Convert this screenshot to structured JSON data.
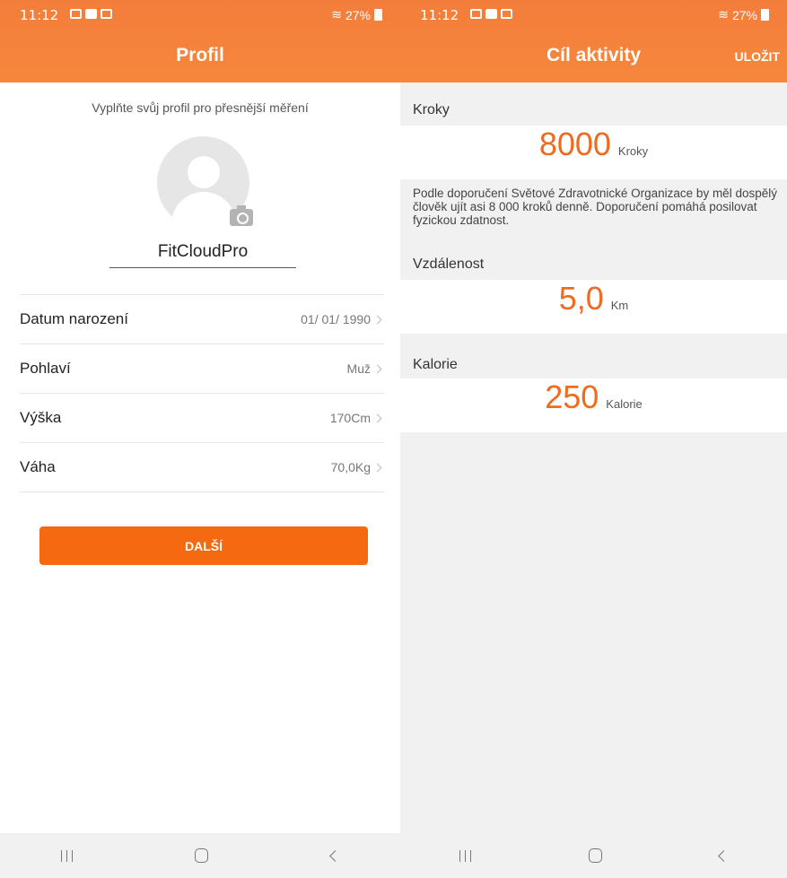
{
  "left": {
    "status": {
      "time": "11:12",
      "signal_battery": "27%"
    },
    "title": "Profil",
    "hint": "Vyplňte svůj profil pro přesnější měření",
    "username": "FitCloudPro",
    "rows": [
      {
        "label": "Datum narození",
        "value": "01/ 01/ 1990"
      },
      {
        "label": "Pohlaví",
        "value": "Muž"
      },
      {
        "label": "Výška",
        "value": "170Cm"
      },
      {
        "label": "Váha",
        "value": "70,0Kg"
      }
    ],
    "next_label": "DALŠÍ"
  },
  "right": {
    "status": {
      "time": "11:12",
      "signal_battery": "27%"
    },
    "title": "Cíl aktivity",
    "save_label": "ULOŽIT",
    "steps": {
      "label": "Kroky",
      "value": "8000",
      "unit": "Kroky"
    },
    "description": "Podle doporučení Světové Zdravotnické Organizace by měl dospělý člověk ujít asi 8 000 kroků denně. Doporučení pomáhá posilovat fyzickou zdatnost.",
    "distance": {
      "label": "Vzdálenost",
      "value": "5,0",
      "unit": "Km"
    },
    "calories": {
      "label": "Kalorie",
      "value": "250",
      "unit": "Kalorie"
    }
  },
  "colors": {
    "header": "#f47d3b",
    "accent": "#f06a1f",
    "button": "#f56a11"
  },
  "icons": [
    "gallery-icon",
    "youtube-icon",
    "check-icon",
    "wifi-icon",
    "signal-icon",
    "battery-icon",
    "camera-icon",
    "avatar-icon",
    "chevron-right-icon",
    "recent-apps-icon",
    "home-icon",
    "back-icon"
  ]
}
